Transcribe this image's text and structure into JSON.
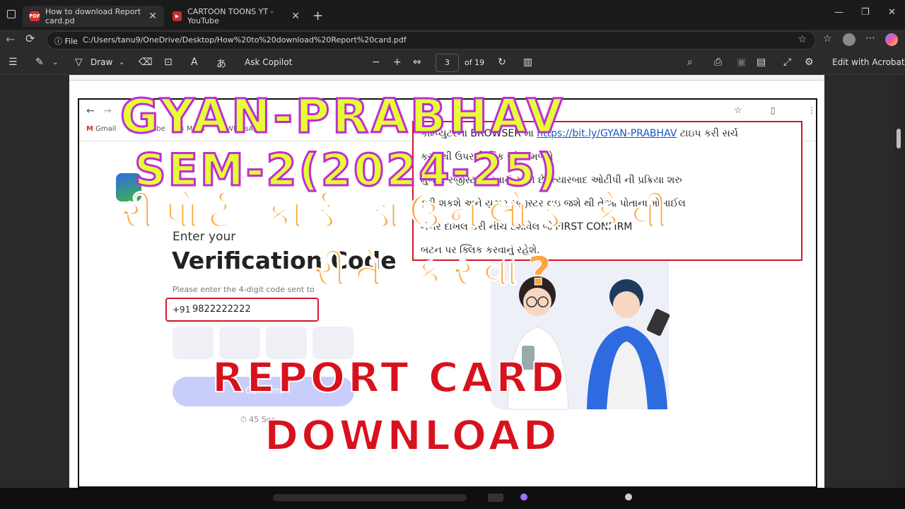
{
  "browser": {
    "tabs": [
      {
        "title": "How to download Report card.pd",
        "favicon": "pdf-icon",
        "color": "#d9312b",
        "active": true
      },
      {
        "title": "CARTOON TOONS YT - YouTube",
        "favicon": "youtube-icon",
        "color": "#c4302b",
        "active": false
      }
    ],
    "address": {
      "prefix": "File",
      "url": "C:/Users/tanu9/OneDrive/Desktop/How%20to%20download%20Report%20card.pdf"
    }
  },
  "pdf_toolbar": {
    "draw_label": "Draw",
    "copilot_label": "Ask Copilot",
    "current_page": "3",
    "page_total": "of 19",
    "edit_label": "Edit with Acrobat"
  },
  "inner": {
    "bookmarks": [
      "Gmail",
      "YouTube",
      "Maps",
      "WhatsApp"
    ],
    "enter_your": "Enter your",
    "verification": "Verification Code",
    "please_enter": "Please enter the 4-digit code sent to",
    "country_code": "+91",
    "phone": "9822222222",
    "confirm": "Confirm",
    "timer": "45 Sec",
    "instructions": {
      "line1_prefix": "કામ્પ્યુટરના BROWSER મા",
      "link": "https://bit.ly/GYAN-PRABHAV",
      "line1_suffix": "ટાઇપ કરી સર્ચ",
      "line2": "કરવાથી ઉપરની લિંક જોવા મળશે",
      "line3": "મુજબ રજીસ્ટર કરવાનું રહેશે છે. ત્યારબાદ ઓટીપી ની પ્રક્રિયા શરુ",
      "line4": "કરી શકશે અને યુઝર રજીસ્ટર થઇ જશે થી તેઓ પોતાના મોબાઈલ",
      "line5": "નંબર દાખલ કરી નીચે દર્શાવેલ જે FIRST CONFIRM",
      "line6": "બટન પર ક્લિક કરવાનું રહેશે."
    }
  },
  "overlay": {
    "title1": "GYAN-PRABHAV",
    "title2": "SEM-2(2024-25)",
    "title3": "રીપોર્ટ કાર્ડ ડાઉનલોડ કેવી",
    "title4": "રીતે કરવા?",
    "title5": "REPORT CARD",
    "title6": "DOWNLOAD"
  },
  "colors": {
    "yellow": "#e6ff33",
    "purple_stroke": "#c02bd8",
    "orange": "#ffa53d",
    "red": "#d8121d"
  }
}
